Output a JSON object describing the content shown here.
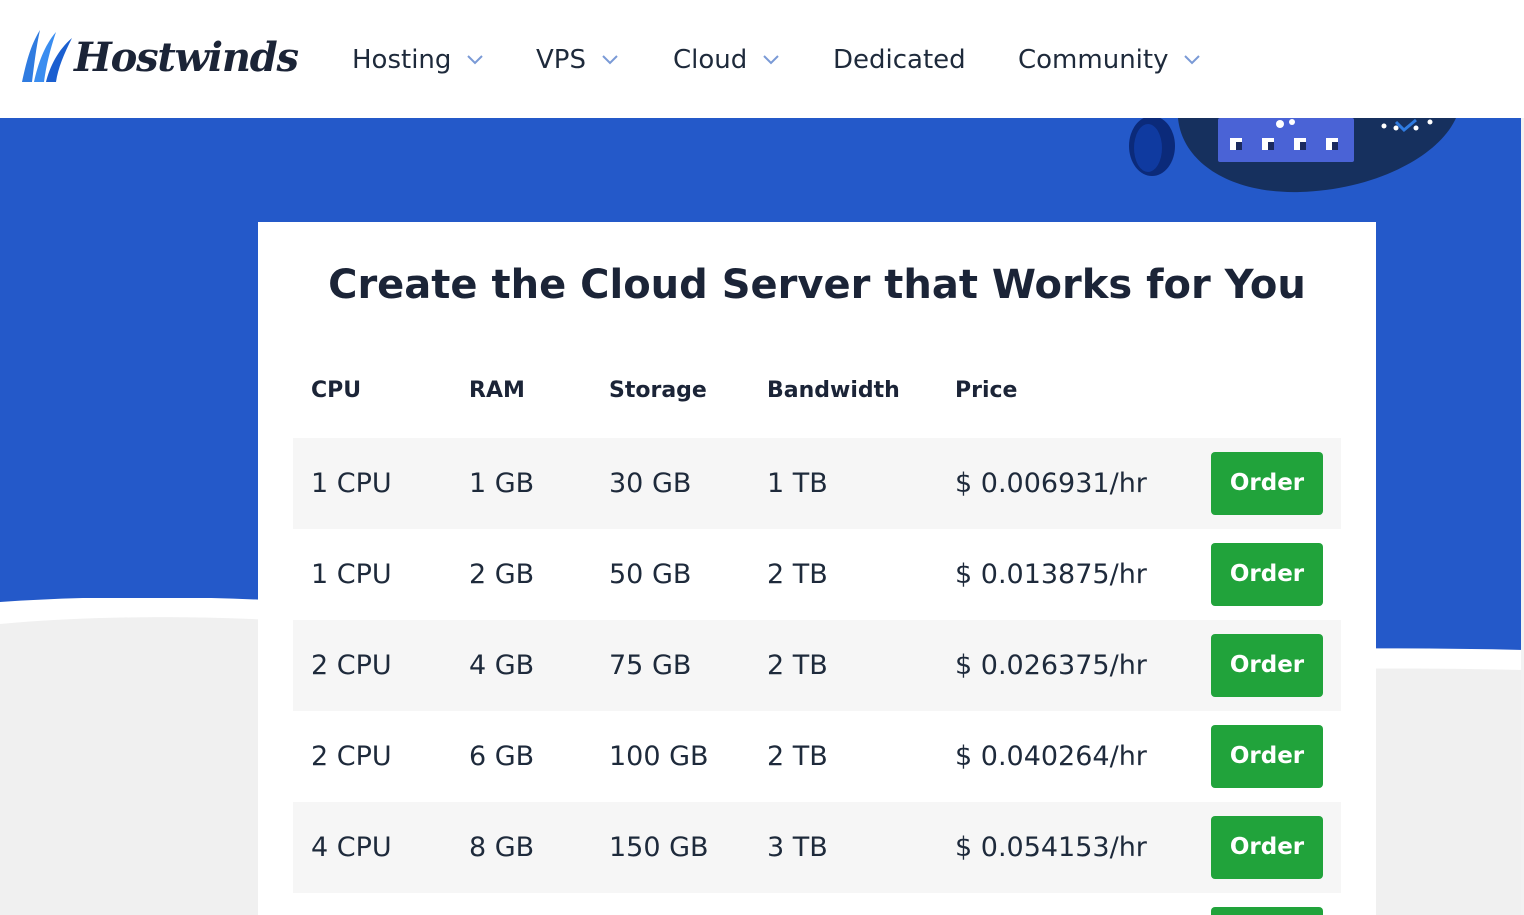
{
  "brand": {
    "name": "Hostwinds",
    "accent": "#2459c9",
    "button_color": "#21a33b"
  },
  "nav": {
    "items": [
      {
        "label": "Hosting",
        "has_dropdown": true,
        "icon": "chevron-down-icon"
      },
      {
        "label": "VPS",
        "has_dropdown": true,
        "icon": "chevron-down-icon"
      },
      {
        "label": "Cloud",
        "has_dropdown": true,
        "icon": "chevron-down-icon"
      },
      {
        "label": "Dedicated",
        "has_dropdown": false
      },
      {
        "label": "Community",
        "has_dropdown": true,
        "icon": "chevron-down-icon"
      }
    ]
  },
  "pricing": {
    "title": "Create the Cloud Server that Works for You",
    "columns": [
      "CPU",
      "RAM",
      "Storage",
      "Bandwidth",
      "Price"
    ],
    "order_label": "Order",
    "rows": [
      {
        "cpu": "1 CPU",
        "ram": "1 GB",
        "storage": "30 GB",
        "bandwidth": "1 TB",
        "price": "$ 0.006931/hr"
      },
      {
        "cpu": "1 CPU",
        "ram": "2 GB",
        "storage": "50 GB",
        "bandwidth": "2 TB",
        "price": "$ 0.013875/hr"
      },
      {
        "cpu": "2 CPU",
        "ram": "4 GB",
        "storage": "75 GB",
        "bandwidth": "2 TB",
        "price": "$ 0.026375/hr"
      },
      {
        "cpu": "2 CPU",
        "ram": "6 GB",
        "storage": "100 GB",
        "bandwidth": "2 TB",
        "price": "$ 0.040264/hr"
      },
      {
        "cpu": "4 CPU",
        "ram": "8 GB",
        "storage": "150 GB",
        "bandwidth": "3 TB",
        "price": "$ 0.054153/hr"
      }
    ]
  }
}
